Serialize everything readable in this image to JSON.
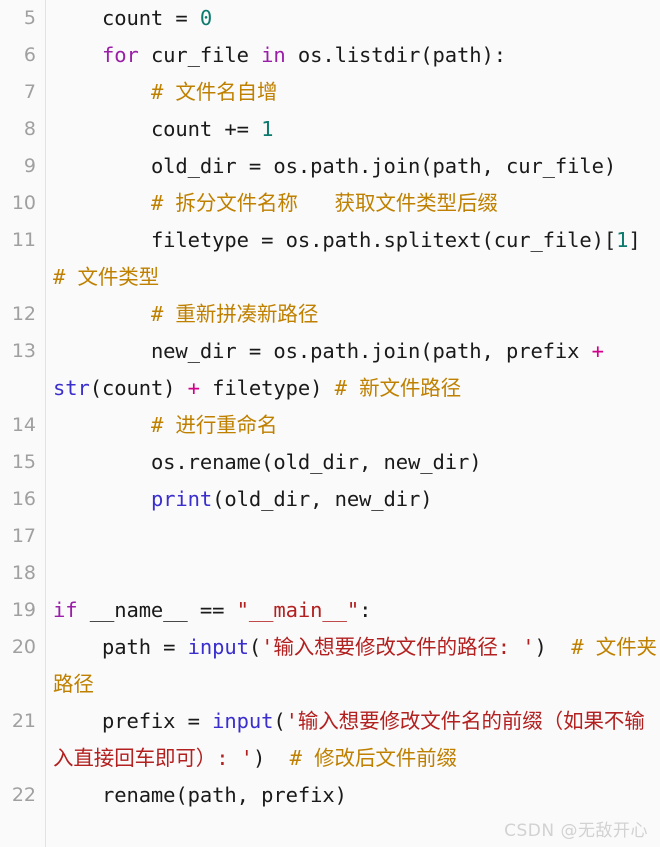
{
  "editor": {
    "language": "python",
    "background_color": "#fafafa",
    "gutter_rule_color": "#e3e3e3",
    "lineno_color": "#a0a0a0",
    "first_line": 5,
    "last_line": 22
  },
  "syntax_colors": {
    "keyword": "#9b1ea8",
    "number": "#0d7a6e",
    "string": "#b32020",
    "comment": "#bf8000",
    "function": "#3a2ecc",
    "operator": "#d1008a",
    "plain": "#1a1a1a"
  },
  "lines": [
    {
      "number": "5",
      "text": "    count = 0",
      "tokens": [
        {
          "t": "    count = ",
          "c": "pl"
        },
        {
          "t": "0",
          "c": "num"
        }
      ]
    },
    {
      "number": "6",
      "text": "    for cur_file in os.listdir(path):",
      "tokens": [
        {
          "t": "    ",
          "c": "pl"
        },
        {
          "t": "for",
          "c": "kw"
        },
        {
          "t": " cur_file ",
          "c": "pl"
        },
        {
          "t": "in",
          "c": "kw"
        },
        {
          "t": " os.listdir(path):",
          "c": "pl"
        }
      ]
    },
    {
      "number": "7",
      "text": "        # 文件名自增",
      "tokens": [
        {
          "t": "        ",
          "c": "pl"
        },
        {
          "t": "# 文件名自增",
          "c": "cmt"
        }
      ]
    },
    {
      "number": "8",
      "text": "        count += 1",
      "tokens": [
        {
          "t": "        count += ",
          "c": "pl"
        },
        {
          "t": "1",
          "c": "num"
        }
      ]
    },
    {
      "number": "9",
      "text": "        old_dir = os.path.join(path, cur_file)",
      "tokens": [
        {
          "t": "        old_dir = os.path.join(path, cur_file)",
          "c": "pl"
        }
      ]
    },
    {
      "number": "10",
      "text": "        # 拆分文件名称   获取文件类型后缀",
      "tokens": [
        {
          "t": "        ",
          "c": "pl"
        },
        {
          "t": "# 拆分文件名称   获取文件类型后缀",
          "c": "cmt"
        }
      ]
    },
    {
      "number": "11",
      "text": "        filetype = os.path.splitext(cur_file)[1]  # 文件类型",
      "tokens": [
        {
          "t": "        filetype = os.path.splitext(cur_file)[",
          "c": "pl"
        },
        {
          "t": "1",
          "c": "num"
        },
        {
          "t": "]  ",
          "c": "pl"
        },
        {
          "t": "# 文件类型",
          "c": "cmt"
        }
      ]
    },
    {
      "number": "12",
      "text": "        # 重新拼凑新路径",
      "tokens": [
        {
          "t": "        ",
          "c": "pl"
        },
        {
          "t": "# 重新拼凑新路径",
          "c": "cmt"
        }
      ]
    },
    {
      "number": "13",
      "text": "        new_dir = os.path.join(path, prefix + str(count) + filetype) # 新文件路径",
      "tokens": [
        {
          "t": "        new_dir = os.path.join(path, prefix ",
          "c": "pl"
        },
        {
          "t": "+",
          "c": "op"
        },
        {
          "t": " ",
          "c": "pl"
        },
        {
          "t": "str",
          "c": "fn"
        },
        {
          "t": "(count) ",
          "c": "pl"
        },
        {
          "t": "+",
          "c": "op"
        },
        {
          "t": " filetype) ",
          "c": "pl"
        },
        {
          "t": "# 新文件路径",
          "c": "cmt"
        }
      ]
    },
    {
      "number": "14",
      "text": "        # 进行重命名",
      "tokens": [
        {
          "t": "        ",
          "c": "pl"
        },
        {
          "t": "# 进行重命名",
          "c": "cmt"
        }
      ]
    },
    {
      "number": "15",
      "text": "        os.rename(old_dir, new_dir)",
      "tokens": [
        {
          "t": "        os.rename(old_dir, new_dir)",
          "c": "pl"
        }
      ]
    },
    {
      "number": "16",
      "text": "        print(old_dir, new_dir)",
      "tokens": [
        {
          "t": "        ",
          "c": "pl"
        },
        {
          "t": "print",
          "c": "fn"
        },
        {
          "t": "(old_dir, new_dir)",
          "c": "pl"
        }
      ]
    },
    {
      "number": "17",
      "text": "",
      "tokens": []
    },
    {
      "number": "18",
      "text": "",
      "tokens": []
    },
    {
      "number": "19",
      "text": "if __name__ == \"__main__\":",
      "tokens": [
        {
          "t": "if",
          "c": "kw"
        },
        {
          "t": " __name__ == ",
          "c": "pl"
        },
        {
          "t": "\"__main__\"",
          "c": "str"
        },
        {
          "t": ":",
          "c": "pl"
        }
      ]
    },
    {
      "number": "20",
      "text": "    path = input('输入想要修改文件的路径: ')  # 文件夹路径",
      "tokens": [
        {
          "t": "    path = ",
          "c": "pl"
        },
        {
          "t": "input",
          "c": "fn"
        },
        {
          "t": "(",
          "c": "pl"
        },
        {
          "t": "'输入想要修改文件的路径: '",
          "c": "str"
        },
        {
          "t": ")  ",
          "c": "pl"
        },
        {
          "t": "# 文件夹路径",
          "c": "cmt"
        }
      ]
    },
    {
      "number": "21",
      "text": "    prefix = input('输入想要修改文件名的前缀（如果不输入直接回车即可）: ')  # 修改后文件前缀",
      "tokens": [
        {
          "t": "    prefix = ",
          "c": "pl"
        },
        {
          "t": "input",
          "c": "fn"
        },
        {
          "t": "(",
          "c": "pl"
        },
        {
          "t": "'输入想要修改文件名的前缀（如果不输入直接回车即可）: '",
          "c": "str"
        },
        {
          "t": ")  ",
          "c": "pl"
        },
        {
          "t": "# 修改后文件前缀",
          "c": "cmt"
        }
      ]
    },
    {
      "number": "22",
      "text": "    rename(path, prefix)",
      "tokens": [
        {
          "t": "    rename(path, prefix)",
          "c": "pl"
        }
      ]
    }
  ],
  "watermark": {
    "text": "CSDN @无敌开心"
  }
}
